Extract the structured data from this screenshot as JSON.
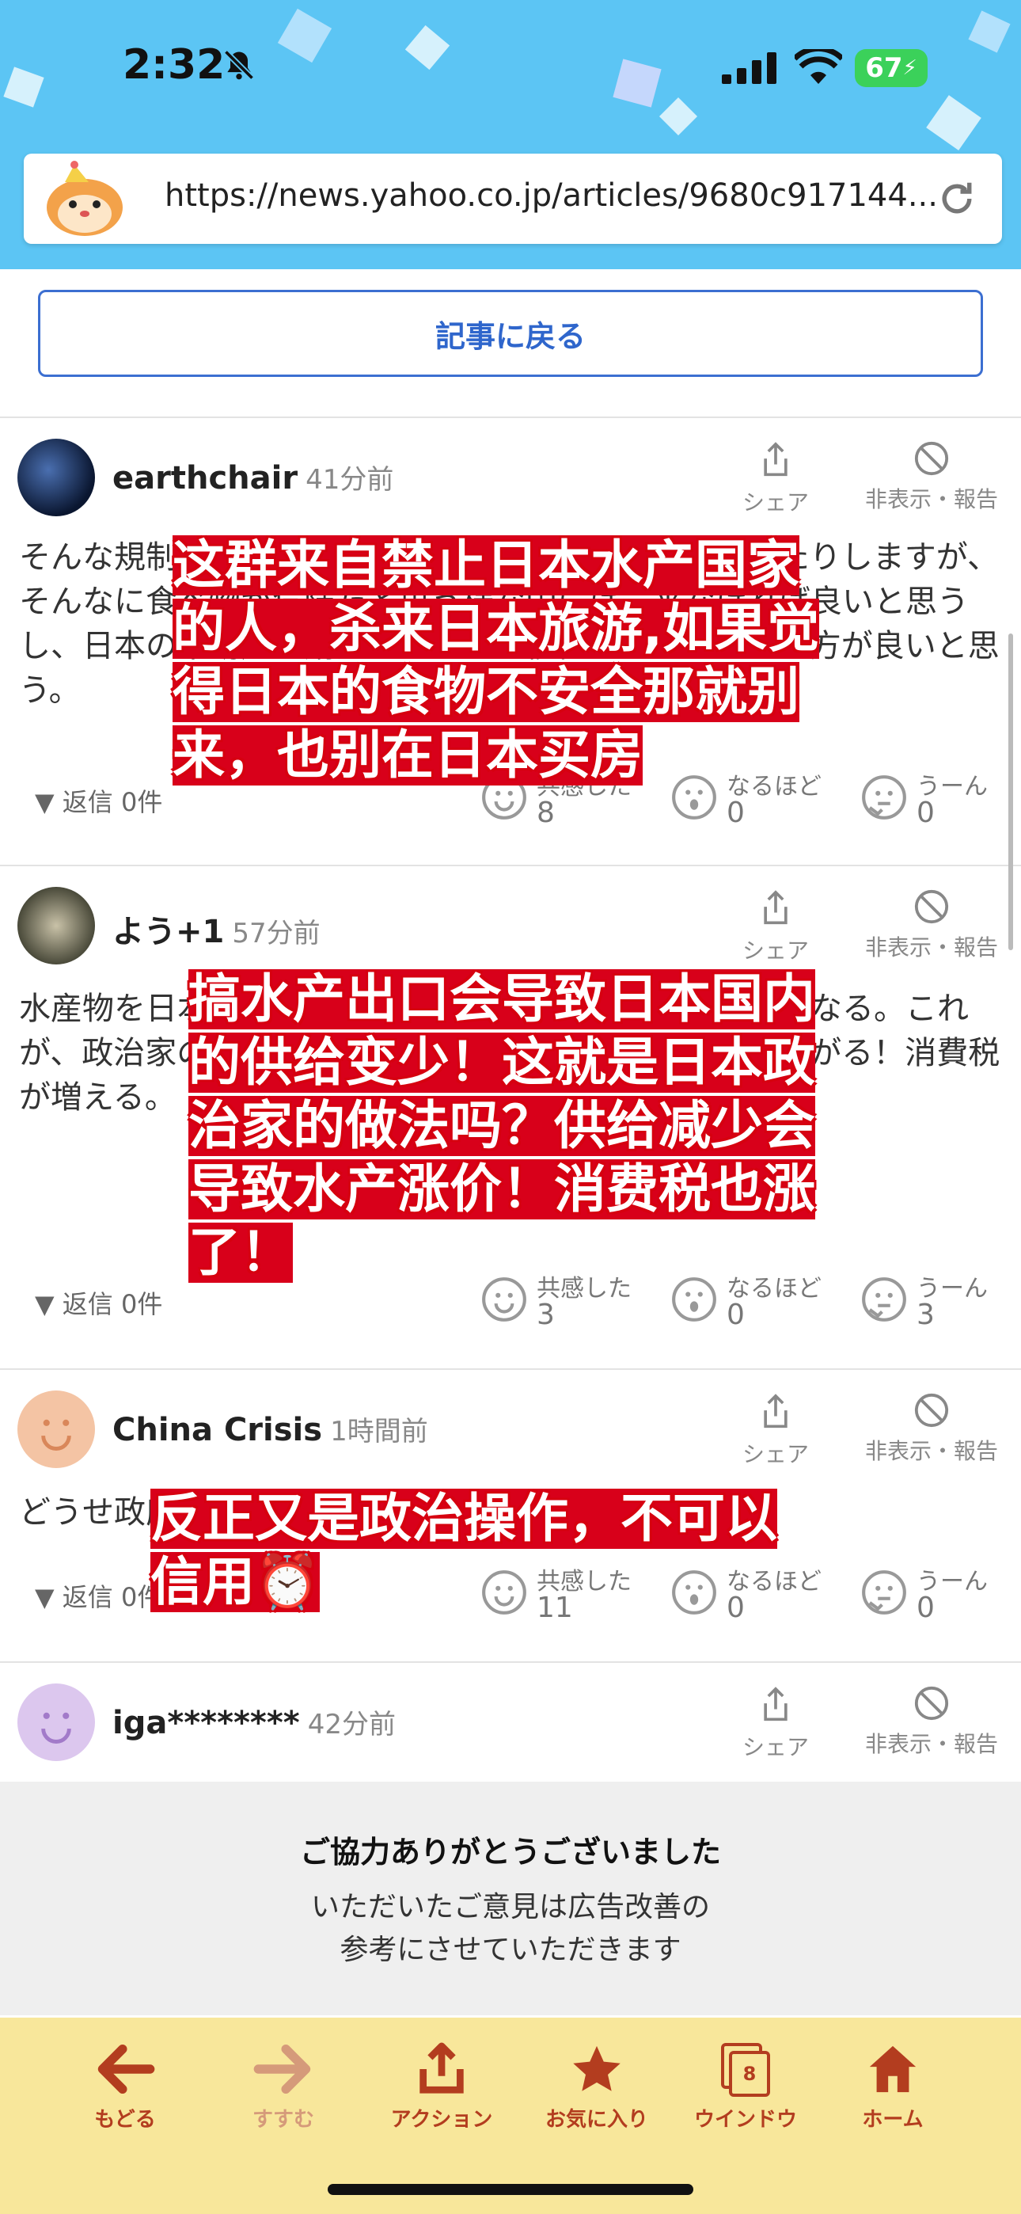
{
  "status": {
    "time": "2:32",
    "battery": "67"
  },
  "browser": {
    "url": "https://news.yahoo.co.jp/articles/9680c917144..."
  },
  "back_button": "記事に戻る",
  "actions": {
    "share": "シェア",
    "hide": "非表示・報告"
  },
  "reaction_labels": {
    "empathy": "共感した",
    "insight": "なるほど",
    "hmm": "うーん"
  },
  "comments": [
    {
      "user": "earthchair",
      "time": "41分前",
      "text": "そんな規制している国から日本国内への観光に来ていたりしますが、そんなに食べ物が危険だと思う様な国には、来なければ良いと思うし、日本の不動産を購入したりして移住するのもやめた方が良いと思う。",
      "reply": "返信 0件",
      "empathy": "8",
      "insight": "0",
      "hmm": "0",
      "overlay": [
        "这群来自禁止日本水产国家",
        "的人，杀来日本旅游,如果觉",
        "得日本的食物不安全那就别",
        "来，也别在日本买房"
      ]
    },
    {
      "user": "よう+1",
      "time": "57分前",
      "text": "水産物を日本から輸出したら日本に残る水産物が少なくなる。これが、政治家のやり方だよ。水産物が少ないなら値段が上がる！消費税が増える。",
      "reply": "返信 0件",
      "empathy": "3",
      "insight": "0",
      "hmm": "3",
      "overlay": [
        "搞水产出口会导致日本国内",
        "的供给变少！这就是日本政",
        "治家的做法吗？供给减少会",
        "导致水产涨价！消费税也涨",
        "了！"
      ]
    },
    {
      "user": "China Crisis",
      "time": "1時間前",
      "text": "どうせ政府の中国への対応は、",
      "reply": "返信 0件",
      "empathy": "11",
      "insight": "0",
      "hmm": "0",
      "overlay": [
        "反正又是政治操作，不可以",
        "信用⏰"
      ]
    },
    {
      "user": "iga********",
      "time": "42分前"
    }
  ],
  "thanks": {
    "title": "ご協力ありがとうございました",
    "line1": "いただいたご意見は広告改善の",
    "line2": "参考にさせていただきます"
  },
  "toolbar": {
    "back": "もどる",
    "forward": "すすむ",
    "action": "アクション",
    "favorite": "お気に入り",
    "window": "ウインドウ",
    "window_count": "8",
    "home": "ホーム"
  },
  "colors": {
    "sky": "#5cc5f4",
    "link_blue": "#2f66cc",
    "overlay_red": "#d8001a",
    "toolbar_bg": "#f8e79b",
    "toolbar_icon": "#b33d1f"
  }
}
